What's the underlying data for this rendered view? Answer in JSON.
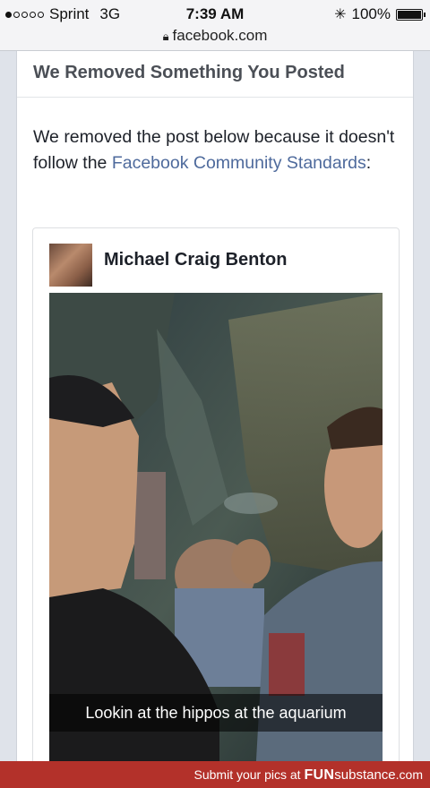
{
  "status_bar": {
    "carrier": "Sprint",
    "network": "3G",
    "time": "7:39 AM",
    "battery": "100%",
    "signal_bars_filled": 1,
    "signal_bars_total": 5
  },
  "browser": {
    "url": "facebook.com"
  },
  "notice": {
    "title": "We Removed Something You Posted",
    "message_before_link": "We removed the post below because it doesn't follow the ",
    "link_text": "Facebook Community Standards",
    "message_after_link": ":"
  },
  "post": {
    "author": "Michael Craig Benton",
    "photo_caption": "Lookin at the hippos at the aquarium"
  },
  "footer": {
    "text": "Submit your pics at",
    "brand_part1": "FUN",
    "brand_part2": "substance",
    "brand_part3": ".com"
  },
  "colors": {
    "link": "#4e6a9c",
    "footer_bg": "#b3312a",
    "title_text": "#4b4f56"
  }
}
